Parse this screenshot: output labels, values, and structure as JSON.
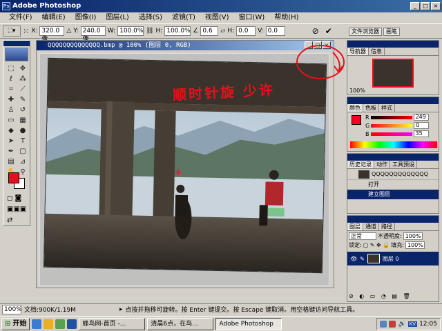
{
  "app": {
    "title": "Adobe Photoshop"
  },
  "menu": [
    "文件(F)",
    "编辑(E)",
    "图像(I)",
    "图层(L)",
    "选择(S)",
    "滤镜(T)",
    "视图(V)",
    "窗口(W)",
    "帮助(H)"
  ],
  "options": {
    "x_label": "X:",
    "x_value": "320.0 像",
    "y_label": "Y:",
    "y_value": "240.0 像",
    "w_label": "W:",
    "w_value": "100.0%",
    "h_label": "H:",
    "h_value": "100.0%",
    "angle_value": "0.6",
    "hskew_label": "H:",
    "hskew_value": "0.0",
    "vskew_label": "V:",
    "vskew_value": "0.0",
    "cancel_icon": "cancel-icon",
    "commit_icon": "check-icon"
  },
  "dock_tabs": [
    "文件浏览器",
    "画笔"
  ],
  "document": {
    "title": "QQQQQQQQQQQQQQ.bmp @ 100% (图层 0, RGB)"
  },
  "annotation": "顺时针旋 少许",
  "navigator": {
    "tabs": [
      "导航器",
      "信息"
    ],
    "zoom": "100%"
  },
  "color": {
    "tabs": [
      "颜色",
      "色板",
      "样式"
    ],
    "r": "249",
    "g": "0",
    "b": "35",
    "r_label": "R",
    "g_label": "G",
    "b_label": "B",
    "fg": "#f90023"
  },
  "history": {
    "tabs": [
      "历史记录",
      "动作",
      "工具预设"
    ],
    "snapshot": "QQQQQQQQQQQQQ",
    "items": [
      "打开",
      "建立图层"
    ]
  },
  "layers": {
    "tabs": [
      "图层",
      "通道",
      "路径"
    ],
    "mode": "正常",
    "opacity_label": "不透明度:",
    "opacity": "100%",
    "lock_label": "锁定:",
    "fill_label": "填充:",
    "fill": "100%",
    "layer_name": "图层 0"
  },
  "status": {
    "zoom": "100%",
    "doc": "文档:900K/1.19M",
    "hint": "点按并拖移可旋转。按 Enter 键提交。按 Escape 键取消。用空格键访问导航工具。"
  },
  "taskbar": {
    "start": "开始",
    "tasks": [
      "蜂鸟网-首页 -...",
      "清晨6点，在鸟...",
      "Adobe Photoshop"
    ],
    "time": "12:05",
    "tray_badge": "KV"
  }
}
